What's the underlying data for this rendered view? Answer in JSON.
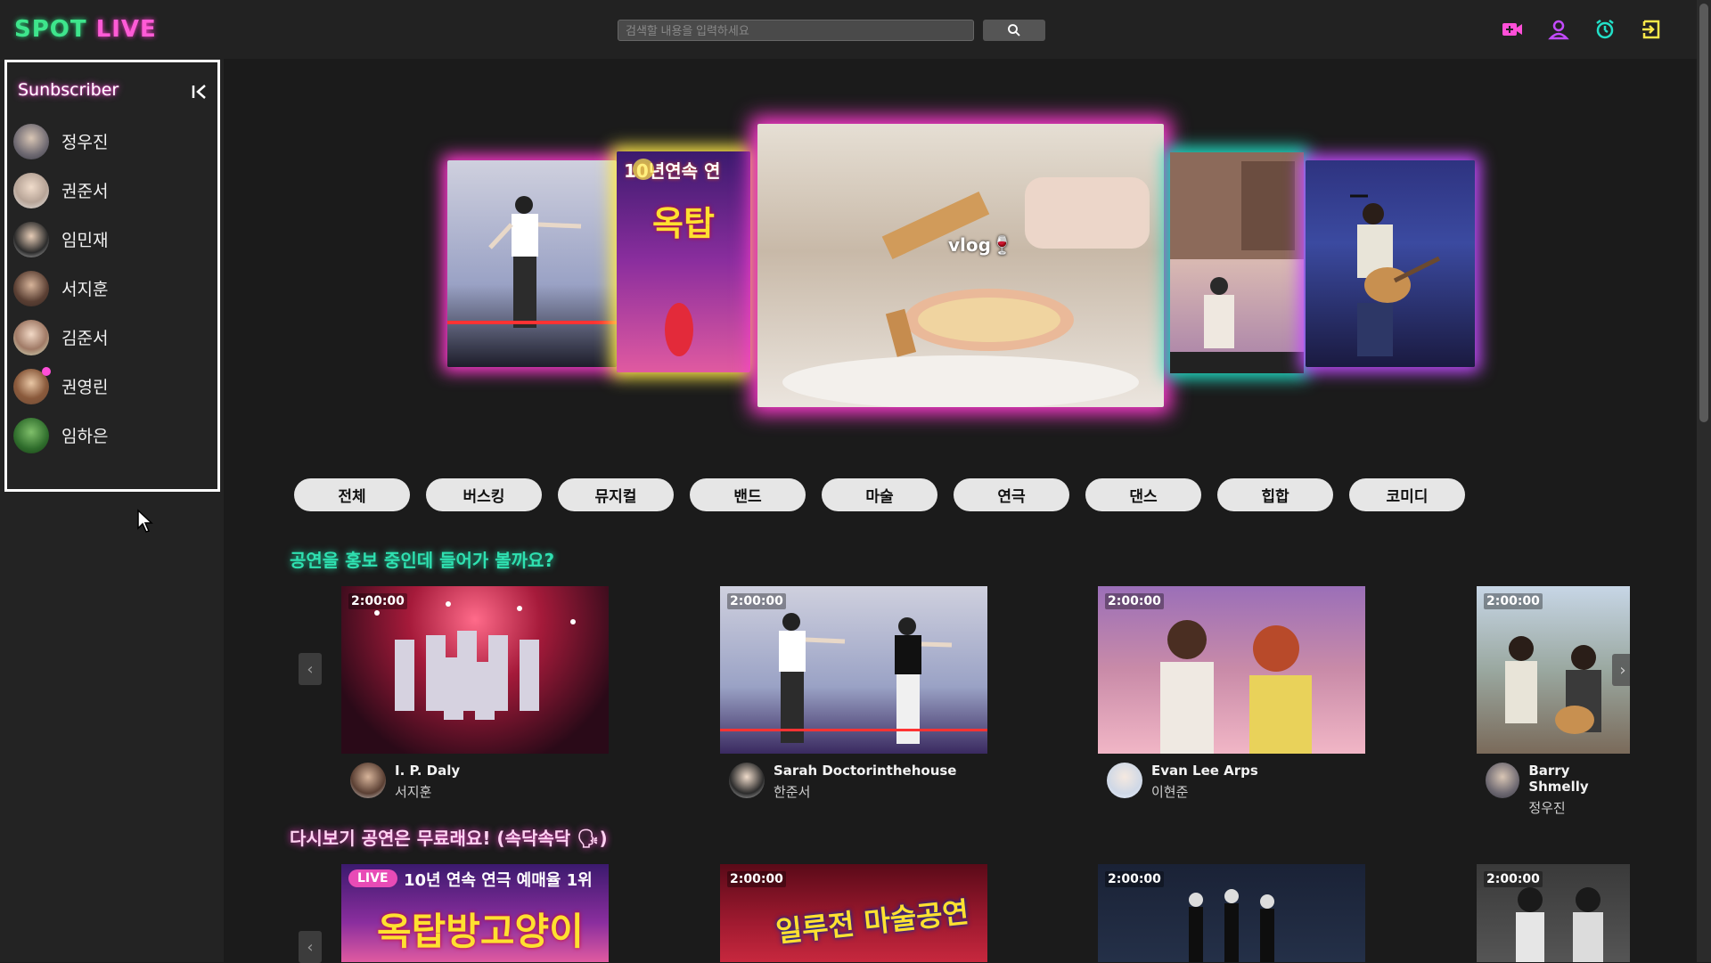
{
  "app": {
    "logo_spot": "SPOT",
    "logo_live": "LIVE"
  },
  "search": {
    "placeholder": "검색할 내용을 입력하세요",
    "icon": "search-icon"
  },
  "top_icons": [
    {
      "name": "video-camera-icon",
      "color": "#ff4fd8"
    },
    {
      "name": "user-icon",
      "color": "#c44bff"
    },
    {
      "name": "alarm-clock-icon",
      "color": "#22e0c8"
    },
    {
      "name": "logout-icon",
      "color": "#ffe94a"
    }
  ],
  "sidebar": {
    "title": "Sunbscriber",
    "collapse_icon": "collapse-left-icon",
    "items": [
      {
        "name": "정우진",
        "live": false
      },
      {
        "name": "권준서",
        "live": false
      },
      {
        "name": "임민재",
        "live": false
      },
      {
        "name": "서지훈",
        "live": false
      },
      {
        "name": "김준서",
        "live": false
      },
      {
        "name": "권영린",
        "live": true
      },
      {
        "name": "임하은",
        "live": false
      }
    ]
  },
  "hero": {
    "vlog_label": "vlog🍷",
    "promo_line1": "10년연속 연",
    "promo_line2": "옥탑"
  },
  "categories": [
    "전체",
    "버스킹",
    "뮤지컬",
    "밴드",
    "마술",
    "연극",
    "댄스",
    "힙합",
    "코미디"
  ],
  "sections": [
    {
      "title": "공연을 홍보 중인데 들어가 볼까요?",
      "cards": [
        {
          "duration": "2:00:00",
          "title": "I. P. Daly",
          "creator": "서지훈"
        },
        {
          "duration": "2:00:00",
          "title": "Sarah Doctorinthehouse",
          "creator": "한준서"
        },
        {
          "duration": "2:00:00",
          "title": "Evan Lee Arps",
          "creator": "이현준"
        },
        {
          "duration": "2:00:00",
          "title": "Barry Shmelly",
          "creator": "정우진"
        }
      ]
    },
    {
      "title": "다시보기 공연은 무료래요! (속닥속닥 🗣)",
      "cards": [
        {
          "badge": "LIVE",
          "overlay_line1": "10년 연속 연극 예매율 1위",
          "overlay_line2": "옥탑방고양이"
        },
        {
          "duration": "2:00:00",
          "overlay_line1": "일루전 마술공연"
        },
        {
          "duration": "2:00:00"
        },
        {
          "duration": "2:00:00"
        }
      ]
    }
  ],
  "colors": {
    "accent_pink": "#ff3bd0",
    "accent_green": "#3ee58c",
    "accent_teal": "#22e0c8",
    "accent_yellow": "#ffe94a",
    "accent_purple": "#c44bff"
  }
}
